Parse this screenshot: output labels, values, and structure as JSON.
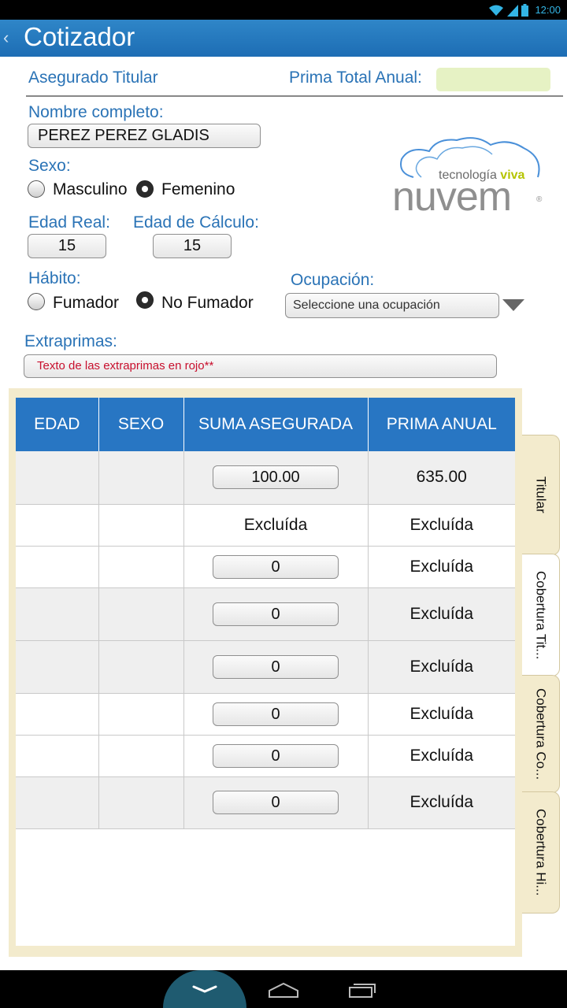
{
  "status_bar": {
    "time": "12:00"
  },
  "app_bar": {
    "title": "Cotizador"
  },
  "form": {
    "insured_label": "Asegurado Titular",
    "total_premium_label": "Prima Total Anual:",
    "total_premium_value": "",
    "name_label": "Nombre completo:",
    "name_value": "PEREZ PEREZ GLADIS",
    "sex_label": "Sexo:",
    "sex_options": [
      "Masculino",
      "Femenino"
    ],
    "sex_selected": "Femenino",
    "real_age_label": "Edad Real:",
    "real_age_value": "15",
    "calc_age_label": "Edad de Cálculo:",
    "calc_age_value": "15",
    "habit_label": "Hábito:",
    "habit_options": [
      "Fumador",
      "No Fumador"
    ],
    "habit_selected": "No Fumador",
    "occupation_label": "Ocupación:",
    "occupation_placeholder": "Seleccione una ocupación",
    "extra_label": "Extraprimas:",
    "extra_value": "Texto de las extraprimas en rojo**"
  },
  "logo": {
    "tagline_1": "tecnología",
    "tagline_2": "viva",
    "brand": "nuvem",
    "mark": "®"
  },
  "table": {
    "headers": [
      "EDAD",
      "SEXO",
      "SUMA ASEGURADA",
      "PRIMA ANUAL"
    ],
    "rows": [
      {
        "edad": "",
        "sexo": "",
        "suma": "100.00",
        "suma_is_input": true,
        "prima": "635.00"
      },
      {
        "edad": "",
        "sexo": "",
        "suma": "Excluída",
        "suma_is_input": false,
        "prima": "Excluída"
      },
      {
        "edad": "",
        "sexo": "",
        "suma": "0",
        "suma_is_input": true,
        "prima": "Excluída"
      },
      {
        "edad": "",
        "sexo": "",
        "suma": "0",
        "suma_is_input": true,
        "prima": "Excluída"
      },
      {
        "edad": "",
        "sexo": "",
        "suma": "0",
        "suma_is_input": true,
        "prima": "Excluída"
      },
      {
        "edad": "",
        "sexo": "",
        "suma": "0",
        "suma_is_input": true,
        "prima": "Excluída"
      },
      {
        "edad": "",
        "sexo": "",
        "suma": "0",
        "suma_is_input": true,
        "prima": "Excluída"
      },
      {
        "edad": "",
        "sexo": "",
        "suma": "0",
        "suma_is_input": true,
        "prima": "Excluída"
      }
    ]
  },
  "side_tabs": [
    {
      "label": "Titular",
      "active": false
    },
    {
      "label": "Cobertura Tit...",
      "active": true
    },
    {
      "label": "Cobertura Co...",
      "active": false
    },
    {
      "label": "Cobertura Hi...",
      "active": false
    }
  ],
  "colors": {
    "app_bar": "#2a7cc0",
    "label_blue": "#2a73b6",
    "header_blue": "#2876c3",
    "panel_beige": "#f3ebcd",
    "premium_field": "#e6f2c4",
    "extra_text_red": "#c8102e",
    "logo_lime": "#b5c400",
    "logo_gray": "#8f8f8f"
  },
  "icons": [
    "wifi-icon",
    "signal-icon",
    "battery-icon",
    "back-chevron-icon",
    "dropdown-arrow-icon",
    "cloud-icon",
    "nav-back-icon",
    "nav-home-icon",
    "nav-recents-icon"
  ]
}
